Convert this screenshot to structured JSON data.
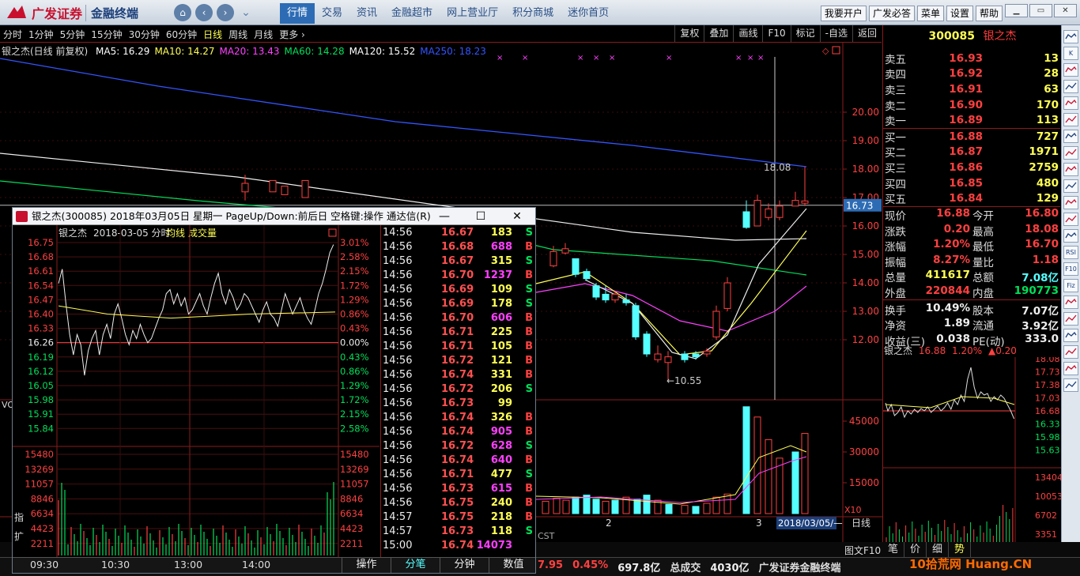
{
  "app": {
    "brand": "广发证券",
    "product": "金融终端",
    "menus": [
      "行情",
      "交易",
      "资讯",
      "金融超市",
      "网上营业厅",
      "积分商城",
      "迷你首页"
    ],
    "active_menu": 0,
    "top_buttons": [
      "我要开户",
      "广发必答",
      "菜单",
      "设置",
      "帮助"
    ]
  },
  "periods": {
    "items": [
      "分时",
      "1分钟",
      "5分钟",
      "15分钟",
      "30分钟",
      "60分钟",
      "日线",
      "周线",
      "月线",
      "更多 ›"
    ],
    "active": 6
  },
  "tools": [
    "复权",
    "叠加",
    "画线",
    "F10",
    "标记",
    "-自选",
    "返回"
  ],
  "main_chart": {
    "title": "银之杰(日线 前复权)",
    "ma": [
      {
        "label": "MA5: 16.29",
        "color": "#ffffff"
      },
      {
        "label": "MA10: 14.27",
        "color": "#ffff54"
      },
      {
        "label": "MA20: 13.43",
        "color": "#ff40ff"
      },
      {
        "label": "MA60: 14.28",
        "color": "#00e05a"
      },
      {
        "label": "MA120: 15.52",
        "color": "#ffffff"
      },
      {
        "label": "MA250: 18.23",
        "color": "#3355ff"
      }
    ],
    "price_ticks": [
      "20.00",
      "19.00",
      "18.00",
      "17.00",
      "16.00",
      "15.00",
      "14.00",
      "13.00",
      "12.00"
    ],
    "current_price_tag": "16.73",
    "high_label": "18.08",
    "low_label": "←10.55",
    "vol_label": "VOL",
    "vol_ticks": [
      "45000",
      "30000",
      "15000"
    ],
    "vol_unit": "X10",
    "month_labels": [
      "2",
      "3"
    ],
    "date_tag": "2018/03/05/—",
    "period_tag": "日线",
    "cst": "CST"
  },
  "quote": {
    "code": "300085",
    "name": "银之杰",
    "asks": [
      {
        "label": "卖五",
        "price": "16.93",
        "vol": "13"
      },
      {
        "label": "卖四",
        "price": "16.92",
        "vol": "28"
      },
      {
        "label": "卖三",
        "price": "16.91",
        "vol": "63"
      },
      {
        "label": "卖二",
        "price": "16.90",
        "vol": "170"
      },
      {
        "label": "卖一",
        "price": "16.89",
        "vol": "113"
      }
    ],
    "bids": [
      {
        "label": "买一",
        "price": "16.88",
        "vol": "727"
      },
      {
        "label": "买二",
        "price": "16.87",
        "vol": "1971"
      },
      {
        "label": "买三",
        "price": "16.86",
        "vol": "2759"
      },
      {
        "label": "买四",
        "price": "16.85",
        "vol": "480"
      },
      {
        "label": "买五",
        "price": "16.84",
        "vol": "129"
      }
    ],
    "stats": [
      [
        "现价",
        "16.88",
        "今开",
        "16.80"
      ],
      [
        "涨跌",
        "0.20",
        "最高",
        "18.08"
      ],
      [
        "涨幅",
        "1.20%",
        "最低",
        "16.70"
      ],
      [
        "振幅",
        "8.27%",
        "量比",
        "1.18"
      ],
      [
        "总量",
        "411617",
        "总额",
        "7.08亿"
      ],
      [
        "外盘",
        "220844",
        "内盘",
        "190773"
      ],
      [
        "换手",
        "10.49%",
        "股本",
        "7.07亿"
      ],
      [
        "净资",
        "1.89",
        "流通",
        "3.92亿"
      ],
      [
        "收益(三)",
        "0.038",
        "PE(动)",
        "333.0"
      ]
    ],
    "mini_title": "银之杰",
    "mini_price": "16.88",
    "mini_change": "1.20%",
    "mini_delta": "▲0.20",
    "mini_ticks": [
      "18.08",
      "17.73",
      "17.38",
      "17.03",
      "16.68",
      "16.33",
      "15.98",
      "15.63"
    ],
    "mini_vol_ticks": [
      "13404",
      "10053",
      "6702",
      "3351"
    ]
  },
  "side_icons": [
    "scroll-up",
    "K",
    "sheet",
    "chart1",
    "chart2",
    "chart3",
    "chart4",
    "chart5",
    "chart6",
    "chart7",
    "chart8",
    "chart9",
    "chart10",
    "RSI",
    "F10",
    "Fiz",
    "chart11",
    "chart12",
    "chart13",
    "chart14",
    "chart15",
    "chart16"
  ],
  "popup": {
    "title": "银之杰(300085) 2018年03月05日 星期一 PageUp/Down:前后日 空格键:操作 通达信(R)",
    "chart_title": "银之杰",
    "chart_date": "2018-03-05 分时",
    "avg_label": "均线",
    "vol_label": "成交量",
    "left_ticks": [
      "16.75",
      "16.68",
      "16.61",
      "16.54",
      "16.47",
      "16.40",
      "16.33",
      "16.26",
      "16.19",
      "16.12",
      "16.05",
      "15.98",
      "15.91",
      "15.84"
    ],
    "right_ticks": [
      "3.01%",
      "2.58%",
      "2.15%",
      "1.72%",
      "1.29%",
      "0.86%",
      "0.43%",
      "0.00%",
      "0.43%",
      "0.86%",
      "1.29%",
      "1.72%",
      "2.15%",
      "2.58%"
    ],
    "vol_ticks": [
      "15480",
      "13269",
      "11057",
      "8846",
      "6634",
      "4423",
      "2211"
    ],
    "time_ticks": [
      "09:30",
      "10:30",
      "13:00",
      "14:00"
    ],
    "side_labels": [
      "指",
      "扩"
    ],
    "tabs": [
      "操作",
      "分笔",
      "分钟",
      "数值"
    ],
    "active_tab": 1,
    "trades": [
      [
        "14:56",
        "16.67",
        "183",
        "S"
      ],
      [
        "14:56",
        "16.68",
        "688",
        "B"
      ],
      [
        "14:56",
        "16.67",
        "315",
        "S"
      ],
      [
        "14:56",
        "16.70",
        "1237",
        "B"
      ],
      [
        "14:56",
        "16.69",
        "109",
        "S"
      ],
      [
        "14:56",
        "16.69",
        "178",
        "S"
      ],
      [
        "14:56",
        "16.70",
        "606",
        "B"
      ],
      [
        "14:56",
        "16.71",
        "225",
        "B"
      ],
      [
        "14:56",
        "16.71",
        "105",
        "B"
      ],
      [
        "14:56",
        "16.72",
        "121",
        "B"
      ],
      [
        "14:56",
        "16.74",
        "331",
        "B"
      ],
      [
        "14:56",
        "16.72",
        "206",
        "S"
      ],
      [
        "14:56",
        "16.73",
        "99",
        ""
      ],
      [
        "14:56",
        "16.74",
        "326",
        "B"
      ],
      [
        "14:56",
        "16.74",
        "905",
        "B"
      ],
      [
        "14:56",
        "16.72",
        "628",
        "S"
      ],
      [
        "14:56",
        "16.74",
        "640",
        "B"
      ],
      [
        "14:56",
        "16.71",
        "477",
        "S"
      ],
      [
        "14:56",
        "16.73",
        "615",
        "B"
      ],
      [
        "14:56",
        "16.75",
        "240",
        "B"
      ],
      [
        "14:57",
        "16.75",
        "218",
        "B"
      ],
      [
        "14:57",
        "16.73",
        "118",
        "S"
      ],
      [
        "15:00",
        "16.74",
        "14073",
        ""
      ]
    ]
  },
  "bottom": {
    "ticker": [
      {
        "text": "7.95",
        "color": "#ff4040"
      },
      {
        "text": "0.45%",
        "color": "#ff4040"
      },
      {
        "text": "697.8亿",
        "color": "#eeeeee"
      },
      {
        "text": "总成交",
        "color": "#dddddd"
      },
      {
        "text": "4030亿",
        "color": "#eeeeee"
      },
      {
        "text": "广发证券金融终端",
        "color": "#dddddd"
      }
    ],
    "right_tabs": [
      "笔",
      "价",
      "细",
      "势"
    ],
    "chart_f10": "图文F10",
    "watermark": "10拾荒网 Huang.CN"
  }
}
